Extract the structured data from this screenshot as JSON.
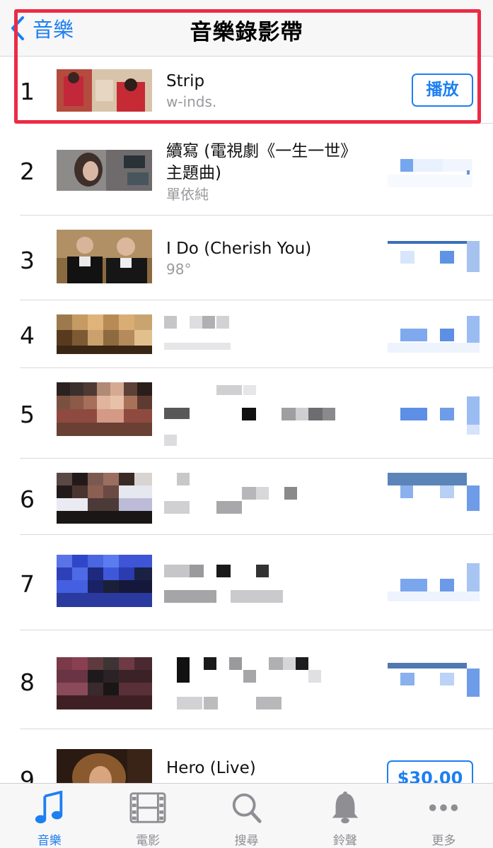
{
  "nav": {
    "back_label": "音樂",
    "title": "音樂錄影帶"
  },
  "rows": [
    {
      "rank": "1",
      "title": "Strip",
      "artist": "w-inds.",
      "button": "播放"
    },
    {
      "rank": "2",
      "title": "續寫 (電視劇《一生一世》主題曲)",
      "artist": "單依純"
    },
    {
      "rank": "3",
      "title": "I Do (Cherish You)",
      "artist": "98°"
    },
    {
      "rank": "4"
    },
    {
      "rank": "5"
    },
    {
      "rank": "6"
    },
    {
      "rank": "7"
    },
    {
      "rank": "8"
    },
    {
      "rank": "9",
      "title": "Hero (Live)",
      "button": "$30.00"
    }
  ],
  "tabs": [
    {
      "label": "音樂",
      "icon": "music-note-icon",
      "active": true
    },
    {
      "label": "電影",
      "icon": "film-icon"
    },
    {
      "label": "搜尋",
      "icon": "search-icon"
    },
    {
      "label": "鈴聲",
      "icon": "bell-icon"
    },
    {
      "label": "更多",
      "icon": "more-icon"
    }
  ],
  "colors": {
    "accent": "#1d7ff1",
    "highlight": "#ec2b45",
    "secondary_text": "#9a9a9f"
  }
}
